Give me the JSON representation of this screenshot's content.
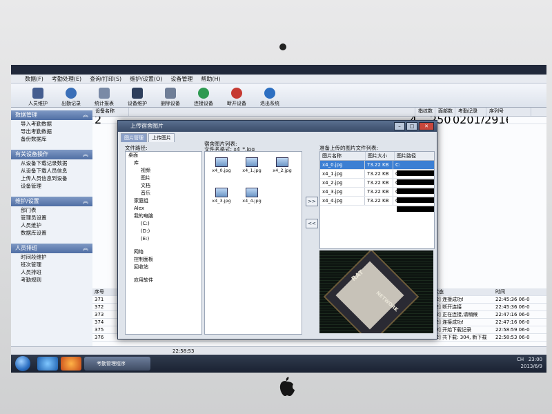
{
  "app": {
    "title": "上传宿舍图片",
    "menu": [
      "数据(F)",
      "考勤处理(E)",
      "查询/打印(S)",
      "维护/设置(O)",
      "设备管理",
      "帮助(H)"
    ],
    "toolbar": [
      "人员维护",
      "出勤记录",
      "统计报表",
      "设备维护",
      "删除设备",
      "连接设备",
      "断开设备",
      "退出系统"
    ],
    "sidebar": [
      {
        "title": "数据管理",
        "items": [
          "导入考勤数据",
          "导出考勤数据",
          "备份数据库"
        ]
      },
      {
        "title": "有关设备操作",
        "items": [
          "从设备下载记录数据",
          "从设备下载人员信息",
          "上传人员信息到设备",
          "设备管理"
        ]
      },
      {
        "title": "维护/设置",
        "items": [
          "部门表",
          "管理员设置",
          "人员维护",
          "数据库设置"
        ]
      },
      {
        "title": "人员排班",
        "items": [
          "时间段维护",
          "班次管理",
          "人员排班",
          "考勤规则"
        ]
      }
    ],
    "main_grid_headers": [
      "设备名称",
      "",
      "",
      "",
      "",
      "",
      "",
      "",
      "",
      "",
      "",
      "",
      "用户数",
      "指纹数",
      "面部数",
      "考勤记录",
      "序列号"
    ],
    "main_grid_row": [
      "2",
      "4",
      "25067",
      "0201/291600006"
    ],
    "log_headers": [
      "序号",
      "状态",
      "时间"
    ],
    "log_rows": [
      {
        "no": "371",
        "status": "[2] 连接成功!",
        "time": "22:45:36 06-0"
      },
      {
        "no": "372",
        "status": "[2] 断开连接",
        "time": "22:45:36 06-0"
      },
      {
        "no": "373",
        "status": "[2] 正在连接,请稍候",
        "time": "22:47:16 06-0"
      },
      {
        "no": "374",
        "status": "[2] 连接成功!",
        "time": "22:47:16 06-0"
      },
      {
        "no": "375",
        "status": "[2] 开始下载记录",
        "time": "22:58:59 06-0"
      },
      {
        "no": "376",
        "status": "[2] 共下载: 304, 新下载",
        "time": "22:58:53 06-0"
      }
    ],
    "status_time": "22:58:53"
  },
  "dialog": {
    "title": "上传宿舍图片",
    "tabs": [
      "图片管理",
      "上传图片"
    ],
    "folder_label": "文件路径:",
    "files_label": "宿舍图片列表:",
    "files_format": "文件名格式: x4_*.jpg",
    "upload_label": "准备上传的图片文件列表:",
    "tree": [
      "桌面",
      "库",
      "视频",
      "图片",
      "文档",
      "音乐",
      "家庭组",
      "Alex",
      "我的电脑",
      "(C:)",
      "(D:)",
      "(E:)",
      "网络",
      "控制面板",
      "回收站",
      "应用软件"
    ],
    "thumbnails": [
      "x4_0.jpg",
      "x4_1.jpg",
      "x4_2.jpg",
      "x4_3.jpg",
      "x4_4.jpg"
    ],
    "grid_headers": [
      "图片名称",
      "图片大小",
      "图片路径"
    ],
    "grid_rows": [
      {
        "name": "x4_0.jpg",
        "size": "73.22 KB",
        "path": "C:"
      },
      {
        "name": "x4_1.jpg",
        "size": "73.22 KB",
        "path": "C:"
      },
      {
        "name": "x4_2.jpg",
        "size": "73.22 KB",
        "path": "C:"
      },
      {
        "name": "x4_3.jpg",
        "size": "73.22 KB",
        "path": "C:"
      },
      {
        "name": "x4_4.jpg",
        "size": "73.22 KB",
        "path": "C:"
      }
    ],
    "btn_add": ">>",
    "btn_remove": "<<",
    "preview_top": "RAT",
    "preview_bottom": "NETWORK"
  },
  "taskbar": {
    "open_app": "考勤管理程序",
    "lang": "CH",
    "time": "23:00",
    "date": "2013/6/9"
  },
  "colors": {
    "accent": "#3c7fd3",
    "section": "#5a77ab"
  }
}
